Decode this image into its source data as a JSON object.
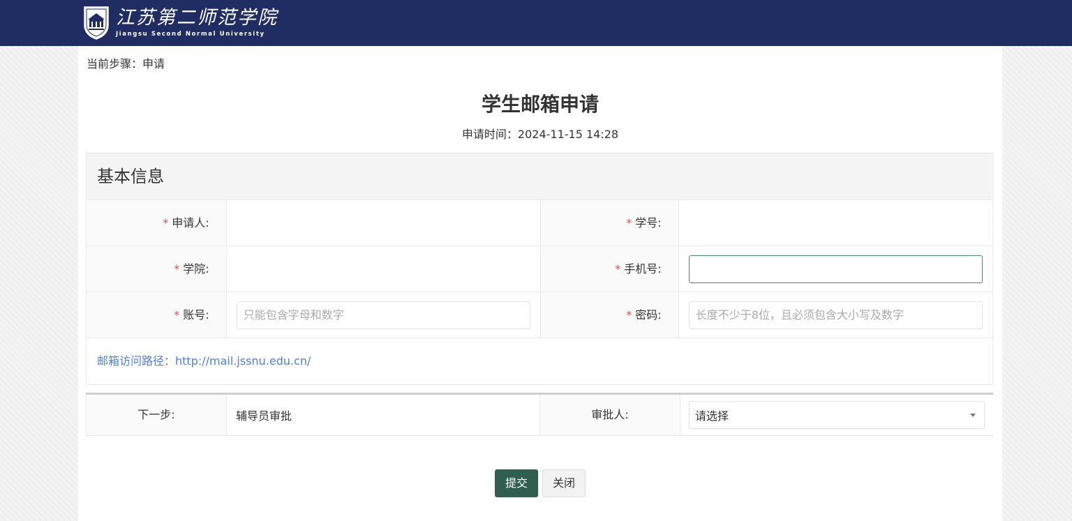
{
  "header": {
    "logo_cn": "江苏第二师范学院",
    "logo_en": "Jiangsu Second Normal University"
  },
  "step": {
    "label": "当前步骤：申请"
  },
  "title": "学生邮箱申请",
  "apply_time": {
    "label": "申请时间：",
    "value": "2024-11-15 14:28"
  },
  "section": {
    "title": "基本信息",
    "applicant_label": "申请人:",
    "student_id_label": "学号:",
    "college_label": "学院:",
    "phone_label": "手机号:",
    "phone_value": "",
    "account_label": "账号:",
    "account_placeholder": "只能包含字母和数字",
    "password_label": "密码:",
    "password_placeholder": "长度不少于8位，且必须包含大小写及数字",
    "mail_link": "邮箱访问路径：http://mail.jssnu.edu.cn/",
    "required_mark": "*"
  },
  "next_step": {
    "label": "下一步:",
    "value": "辅导员审批",
    "approver_label": "审批人:",
    "approver_selected": "请选择"
  },
  "buttons": {
    "submit": "提交",
    "close": "关闭"
  },
  "colors": {
    "header_bg": "#1f2d63",
    "primary_button": "#2f5d4f",
    "link": "#4f7fd8",
    "required": "#d9534f"
  }
}
